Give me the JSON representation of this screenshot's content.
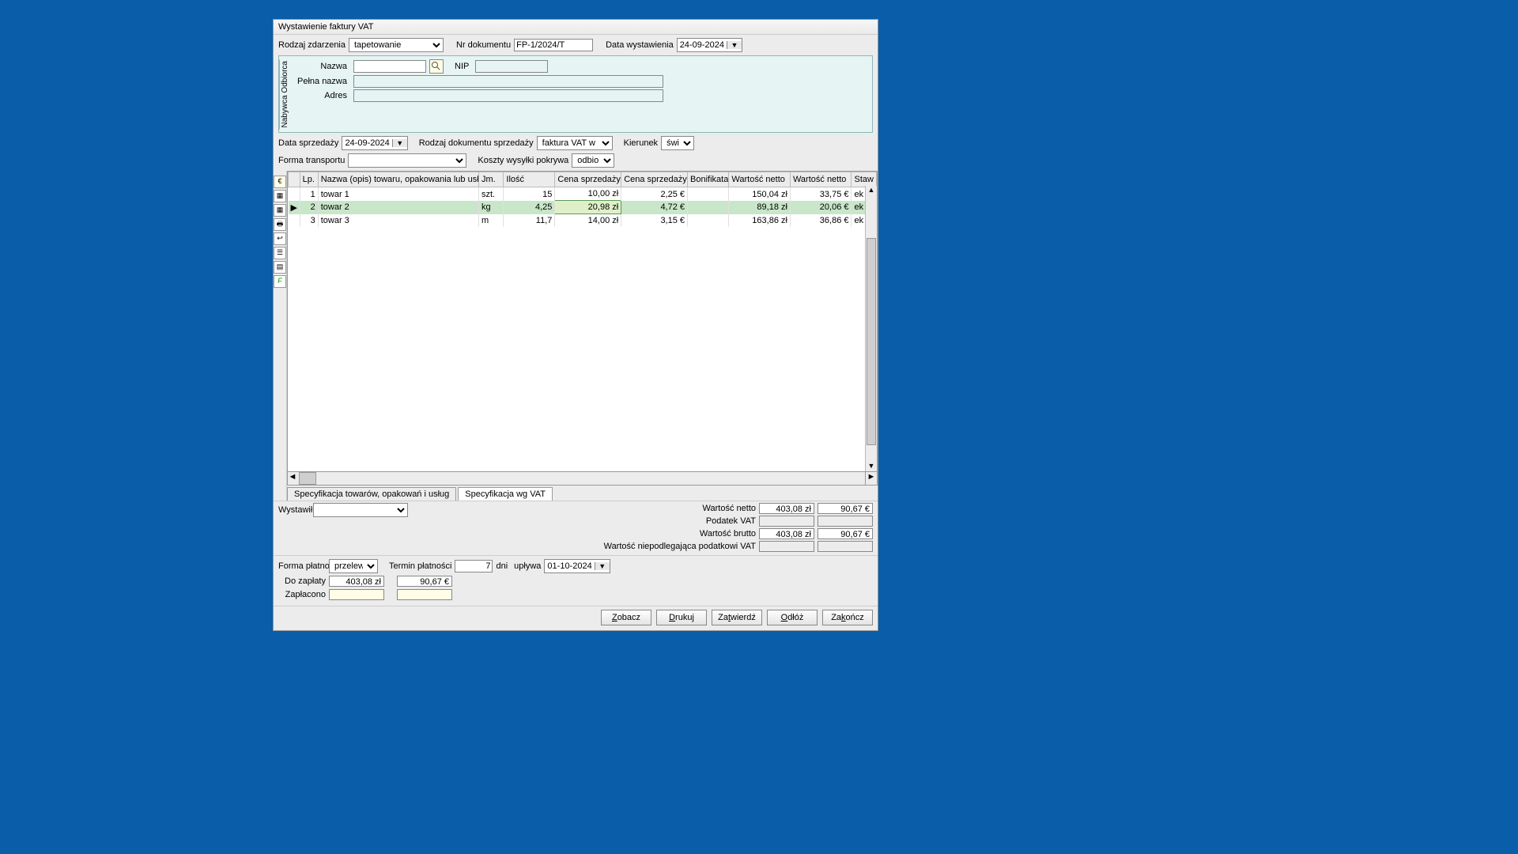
{
  "title": "Wystawienie faktury VAT",
  "header": {
    "event_type_label": "Rodzaj zdarzenia",
    "event_type_value": "tapetowanie",
    "doc_nr_label": "Nr dokumentu",
    "doc_nr_value": "FP-1/2024/T",
    "issue_date_label": "Data wystawienia",
    "issue_date_value": "24-09-2024"
  },
  "buyer": {
    "tab_label": "Nabywca\nOdbiorca",
    "name_label": "Nazwa",
    "name_value": "",
    "nip_label": "NIP",
    "nip_value": "",
    "full_name_label": "Pełna nazwa",
    "full_name_value": "",
    "address_label": "Adres",
    "address_value": ""
  },
  "line2": {
    "sale_date_label": "Data sprzedaży",
    "sale_date_value": "24-09-2024",
    "doc_type_label": "Rodzaj dokumentu sprzedaży",
    "doc_type_value": "faktura VAT w euro",
    "direction_label": "Kierunek",
    "direction_value": "świat"
  },
  "line3": {
    "transport_label": "Forma transportu",
    "transport_value": "",
    "ship_cost_label": "Koszty wysyłki pokrywa",
    "ship_cost_value": "odbiorca"
  },
  "side_icons": [
    "€",
    "1",
    "2",
    "3",
    "4",
    "5",
    "6",
    "F"
  ],
  "grid": {
    "columns": [
      "",
      "Lp.",
      "Nazwa (opis) towaru, opakowania lub usługi",
      "Jm.",
      "Ilość",
      "Cena sprzedaży netto",
      "Cena sprzedaży netto",
      "Bonifikata",
      "Wartość netto",
      "Wartość netto",
      "Staw"
    ],
    "rows": [
      {
        "lp": "1",
        "name": "towar 1",
        "jm": "szt.",
        "ilosc": "15",
        "c1": "10,00 zł",
        "c2": "2,25 €",
        "bon": "",
        "wn1": "150,04 zł",
        "wn2": "33,75 €",
        "st": "ek"
      },
      {
        "lp": "2",
        "name": "towar 2",
        "jm": "kg",
        "ilosc": "4,25",
        "c1": "20,98 zł",
        "c2": "4,72 €",
        "bon": "",
        "wn1": "89,18 zł",
        "wn2": "20,06 €",
        "st": "ek",
        "selected": true
      },
      {
        "lp": "3",
        "name": "towar 3",
        "jm": "m",
        "ilosc": "11,7",
        "c1": "14,00 zł",
        "c2": "3,15 €",
        "bon": "",
        "wn1": "163,86 zł",
        "wn2": "36,86 €",
        "st": "ek"
      }
    ]
  },
  "tabs": {
    "t1": "Specyfikacja towarów, opakowań i usług",
    "t2": "Specyfikacja wg VAT"
  },
  "issuer_label": "Wystawił",
  "issuer_value": "",
  "totals": {
    "net_label": "Wartość netto",
    "net_zl": "403,08 zł",
    "net_eur": "90,67 €",
    "vat_label": "Podatek VAT",
    "vat_zl": "",
    "vat_eur": "",
    "gross_label": "Wartość brutto",
    "gross_zl": "403,08 zł",
    "gross_eur": "90,67 €",
    "novat_label": "Wartość niepodlegająca podatkowi VAT",
    "novat_zl": "",
    "novat_eur": ""
  },
  "payment": {
    "form_label": "Forma płatności",
    "form_value": "przelew",
    "term_label": "Termin płatności",
    "term_days": "7",
    "term_unit": "dni",
    "expires_label": "upływa",
    "expires_value": "01-10-2024",
    "to_pay_label": "Do zapłaty",
    "to_pay_zl": "403,08 zł",
    "to_pay_eur": "90,67 €",
    "paid_label": "Zapłacono",
    "paid_zl": "",
    "paid_eur": ""
  },
  "buttons": {
    "view": "Zobacz",
    "print": "Drukuj",
    "approve": "Zatwierdź",
    "reject": "Odłóż",
    "close": "Zakończ"
  }
}
